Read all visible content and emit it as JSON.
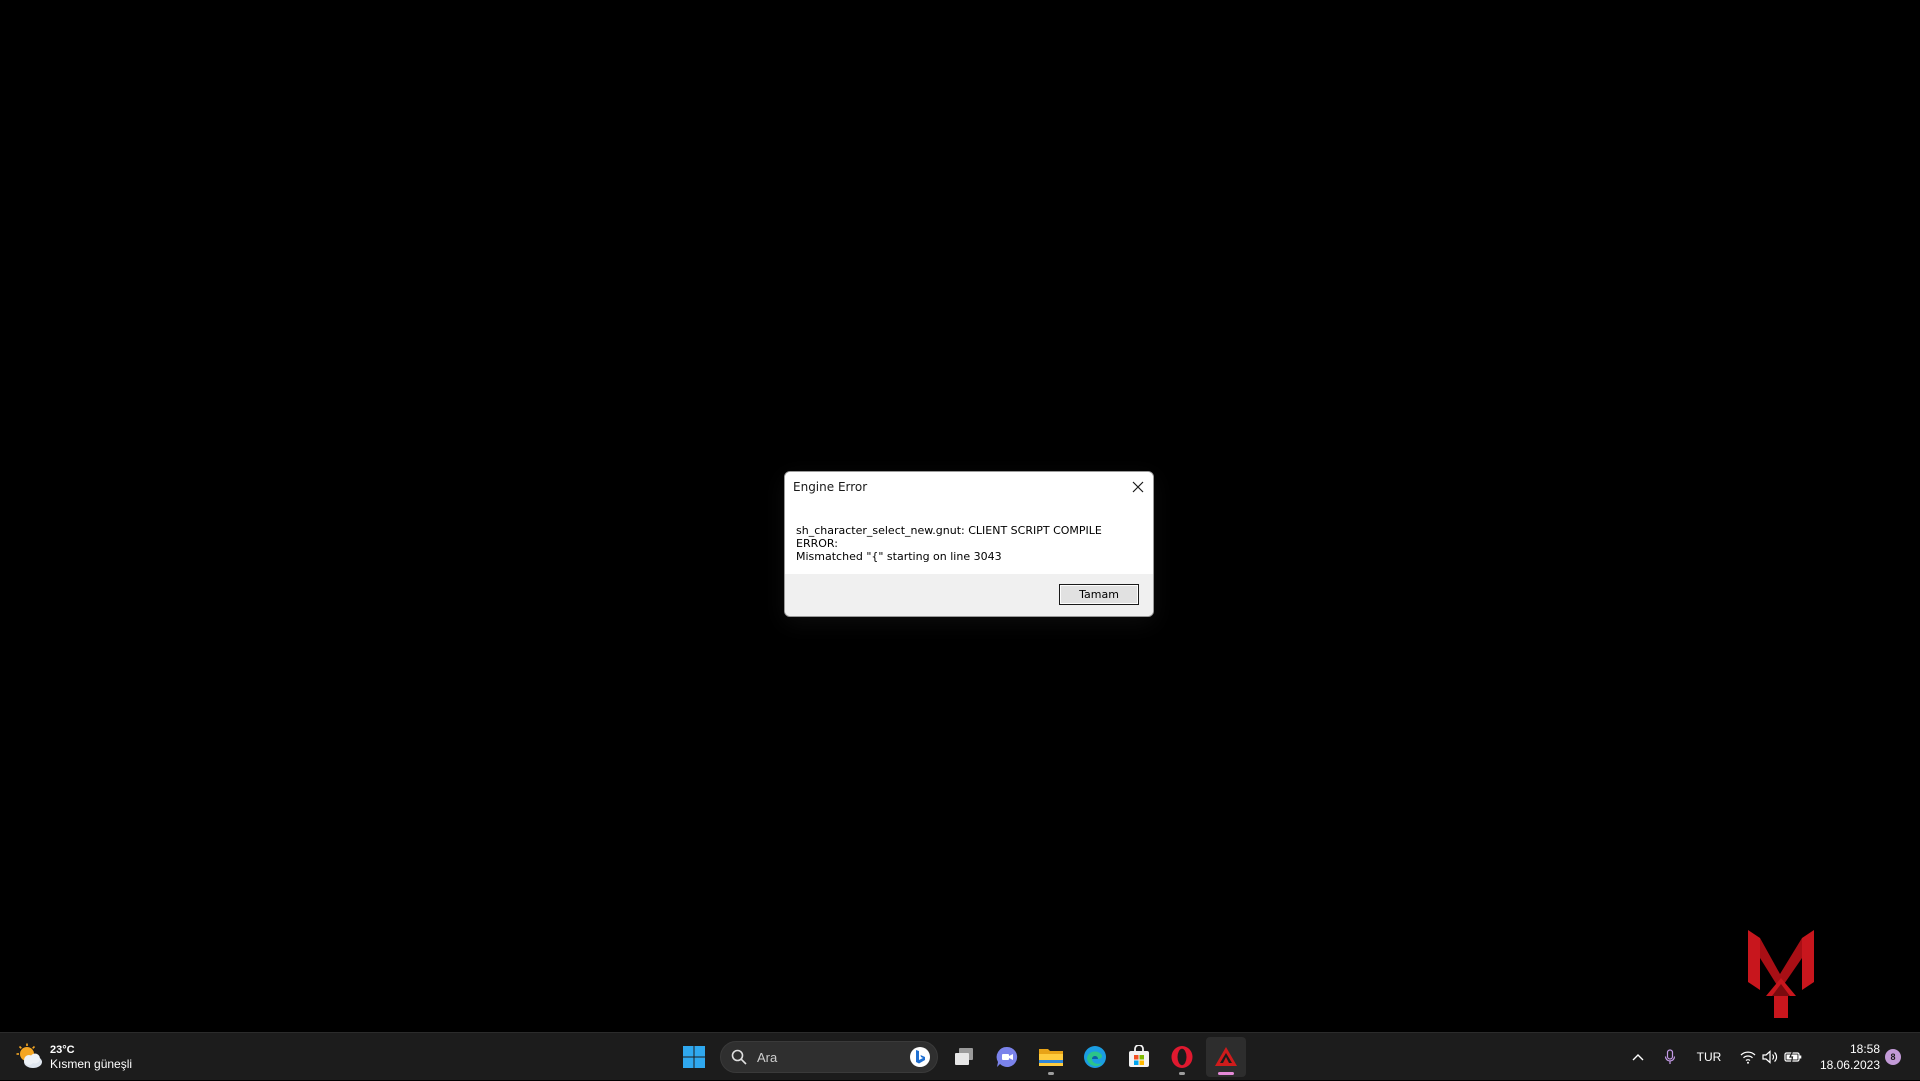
{
  "dialog": {
    "title": "Engine Error",
    "message_line1": "sh_character_select_new.gnut: CLIENT SCRIPT COMPILE ERROR:",
    "message_line2": "Mismatched \"{\" starting on line 3043",
    "ok_label": "Tamam"
  },
  "taskbar": {
    "weather": {
      "temperature": "23°C",
      "description": "Kısmen güneşli"
    },
    "search": {
      "placeholder": "Ara"
    },
    "pinned": [
      {
        "name": "Start",
        "icon": "windows-start-icon"
      },
      {
        "name": "Search",
        "icon": "search-icon"
      },
      {
        "name": "Task View",
        "icon": "task-view-icon"
      },
      {
        "name": "Teams Chat",
        "icon": "teams-chat-icon"
      },
      {
        "name": "File Explorer",
        "icon": "folder-icon"
      },
      {
        "name": "Microsoft Edge",
        "icon": "edge-icon"
      },
      {
        "name": "Microsoft Store",
        "icon": "store-icon"
      },
      {
        "name": "Opera",
        "icon": "opera-icon"
      },
      {
        "name": "Apex Legends",
        "icon": "apex-icon"
      }
    ],
    "tray": {
      "language": "TUR",
      "time": "18:58",
      "date": "18.06.2023",
      "notification_count": "8"
    }
  },
  "colors": {
    "desktop_bg": "#000000",
    "taskbar_bg": "#1c1c1c",
    "dialog_footer_bg": "#f0f0f0",
    "logo_red": "#c8161d",
    "active_indicator": "#e58ad8"
  }
}
